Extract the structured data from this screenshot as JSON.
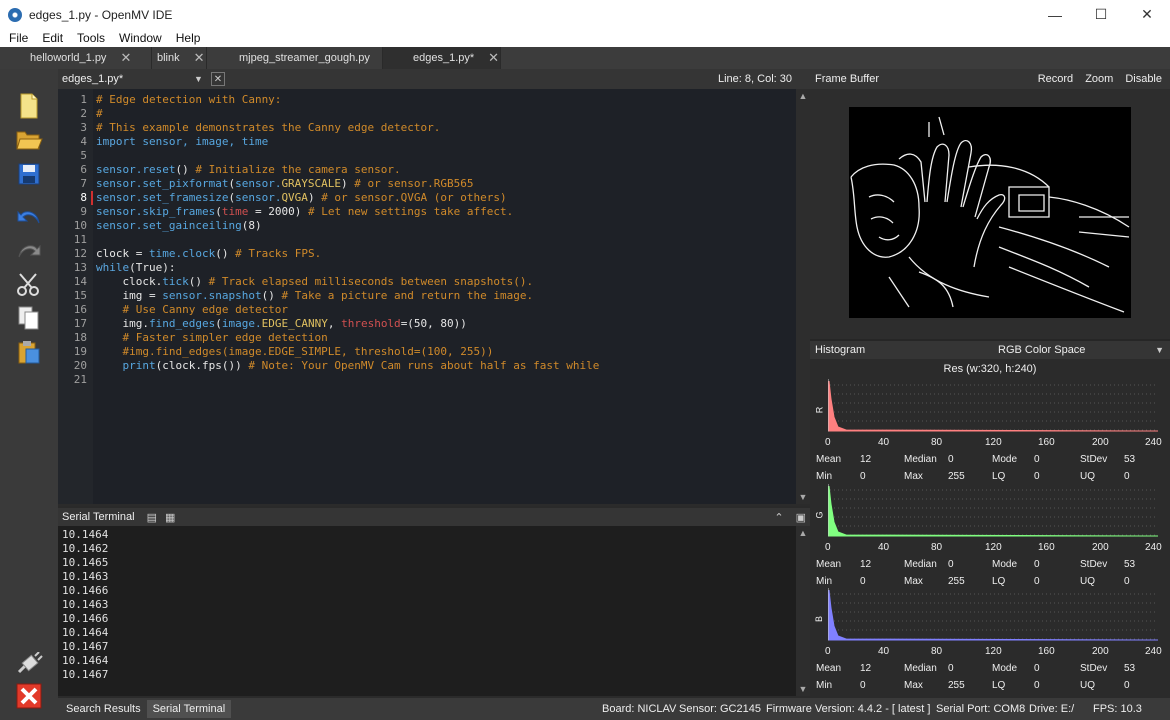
{
  "window": {
    "title": "edges_1.py - OpenMV IDE"
  },
  "menu": [
    "File",
    "Edit",
    "Tools",
    "Window",
    "Help"
  ],
  "tabs": [
    {
      "label": "helloworld_1.py",
      "active": false
    },
    {
      "label": "blink",
      "active": false
    },
    {
      "label": "mjpeg_streamer_gough.py",
      "active": false
    },
    {
      "label": "edges_1.py*",
      "active": true
    }
  ],
  "editor": {
    "file_label": "edges_1.py*",
    "cursor_pos": "Line: 8, Col: 30",
    "current_line": 8,
    "line_numbers": [
      "1",
      "2",
      "3",
      "4",
      "5",
      "6",
      "7",
      "8",
      "9",
      "10",
      "11",
      "12",
      "13",
      "14",
      "15",
      "16",
      "17",
      "18",
      "19",
      "20",
      "21"
    ],
    "lines": [
      [
        {
          "t": "# Edge detection with Canny:",
          "c": "comment"
        }
      ],
      [
        {
          "t": "#",
          "c": "comment"
        }
      ],
      [
        {
          "t": "# This example demonstrates the Canny edge detector.",
          "c": "comment"
        }
      ],
      [
        {
          "t": "import ",
          "c": "kw"
        },
        {
          "t": "sensor, image, time",
          "c": "fn"
        }
      ],
      [],
      [
        {
          "t": "sensor.reset",
          "c": "fn"
        },
        {
          "t": "() ",
          "c": "plain"
        },
        {
          "t": "# Initialize the camera sensor.",
          "c": "comment"
        }
      ],
      [
        {
          "t": "sensor.set_pixformat",
          "c": "fn"
        },
        {
          "t": "(",
          "c": "plain"
        },
        {
          "t": "sensor.",
          "c": "fn"
        },
        {
          "t": "GRAYSCALE",
          "c": "const"
        },
        {
          "t": ") ",
          "c": "plain"
        },
        {
          "t": "# or sensor.RGB565",
          "c": "comment"
        }
      ],
      [
        {
          "t": "sensor.set_framesize",
          "c": "fn"
        },
        {
          "t": "(",
          "c": "plain"
        },
        {
          "t": "sensor.",
          "c": "fn"
        },
        {
          "t": "QVGA",
          "c": "const"
        },
        {
          "t": ") ",
          "c": "plain"
        },
        {
          "t": "# or sensor.QVGA (or others)",
          "c": "comment"
        }
      ],
      [
        {
          "t": "sensor.skip_frames",
          "c": "fn"
        },
        {
          "t": "(",
          "c": "plain"
        },
        {
          "t": "time",
          "c": "param"
        },
        {
          "t": " = 2000) ",
          "c": "plain"
        },
        {
          "t": "# Let new settings take affect.",
          "c": "comment"
        }
      ],
      [
        {
          "t": "sensor.set_gainceiling",
          "c": "fn"
        },
        {
          "t": "(8)",
          "c": "plain"
        }
      ],
      [],
      [
        {
          "t": "clock = ",
          "c": "plain"
        },
        {
          "t": "time.clock",
          "c": "fn"
        },
        {
          "t": "() ",
          "c": "plain"
        },
        {
          "t": "# Tracks FPS.",
          "c": "comment"
        }
      ],
      [
        {
          "t": "while",
          "c": "kw"
        },
        {
          "t": "(True):",
          "c": "plain"
        }
      ],
      [
        {
          "t": "    clock.",
          "c": "plain"
        },
        {
          "t": "tick",
          "c": "fn"
        },
        {
          "t": "() ",
          "c": "plain"
        },
        {
          "t": "# Track elapsed milliseconds between snapshots().",
          "c": "comment"
        }
      ],
      [
        {
          "t": "    img = ",
          "c": "plain"
        },
        {
          "t": "sensor.snapshot",
          "c": "fn"
        },
        {
          "t": "() ",
          "c": "plain"
        },
        {
          "t": "# Take a picture and return the image.",
          "c": "comment"
        }
      ],
      [
        {
          "t": "    # Use Canny edge detector",
          "c": "comment"
        }
      ],
      [
        {
          "t": "    img.",
          "c": "plain"
        },
        {
          "t": "find_edges",
          "c": "fn"
        },
        {
          "t": "(",
          "c": "plain"
        },
        {
          "t": "image.",
          "c": "fn"
        },
        {
          "t": "EDGE_CANNY",
          "c": "const"
        },
        {
          "t": ", ",
          "c": "plain"
        },
        {
          "t": "threshold",
          "c": "param"
        },
        {
          "t": "=(50, 80))",
          "c": "plain"
        }
      ],
      [
        {
          "t": "    # Faster simpler edge detection",
          "c": "comment"
        }
      ],
      [
        {
          "t": "    #img.find_edges(image.EDGE_SIMPLE, threshold=(100, 255))",
          "c": "comment"
        }
      ],
      [
        {
          "t": "    ",
          "c": "plain"
        },
        {
          "t": "print",
          "c": "fn"
        },
        {
          "t": "(clock.fps()) ",
          "c": "plain"
        },
        {
          "t": "# Note: Your OpenMV Cam runs about half as fast while",
          "c": "comment"
        }
      ],
      []
    ]
  },
  "serial": {
    "label": "Serial Terminal",
    "lines": [
      "10.1464",
      "10.1462",
      "10.1465",
      "10.1463",
      "10.1466",
      "10.1463",
      "10.1466",
      "10.1464",
      "10.1467",
      "10.1464",
      "10.1467"
    ]
  },
  "status": {
    "tabs": [
      "Search Results",
      "Serial Terminal"
    ],
    "board": "Board: NICLAV",
    "sensor": "Sensor: GC2145",
    "firmware": "Firmware Version: 4.4.2 - [ latest ]",
    "port": "Serial Port: COM8",
    "drive": "Drive: E:/",
    "fps": "FPS: 10.3"
  },
  "framebuffer": {
    "label": "Frame Buffer",
    "actions": [
      "Record",
      "Zoom",
      "Disable"
    ]
  },
  "histogram": {
    "label": "Histogram",
    "color_space": "RGB Color Space",
    "res": "Res (w:320, h:240)",
    "axis": [
      "0",
      "40",
      "80",
      "120",
      "160",
      "200",
      "240"
    ],
    "channels": [
      {
        "name": "R",
        "color": "#ff8080",
        "stats": {
          "mean": "12",
          "median": "0",
          "mode": "0",
          "stdev": "53",
          "min": "0",
          "max": "255",
          "lq": "0",
          "uq": "0"
        }
      },
      {
        "name": "G",
        "color": "#80ff80",
        "stats": {
          "mean": "12",
          "median": "0",
          "mode": "0",
          "stdev": "53",
          "min": "0",
          "max": "255",
          "lq": "0",
          "uq": "0"
        }
      },
      {
        "name": "B",
        "color": "#8080ff",
        "stats": {
          "mean": "12",
          "median": "0",
          "mode": "0",
          "stdev": "53",
          "min": "0",
          "max": "255",
          "lq": "0",
          "uq": "0"
        }
      }
    ],
    "stat_labels": {
      "mean": "Mean",
      "median": "Median",
      "mode": "Mode",
      "stdev": "StDev",
      "min": "Min",
      "max": "Max",
      "lq": "LQ",
      "uq": "UQ"
    }
  }
}
